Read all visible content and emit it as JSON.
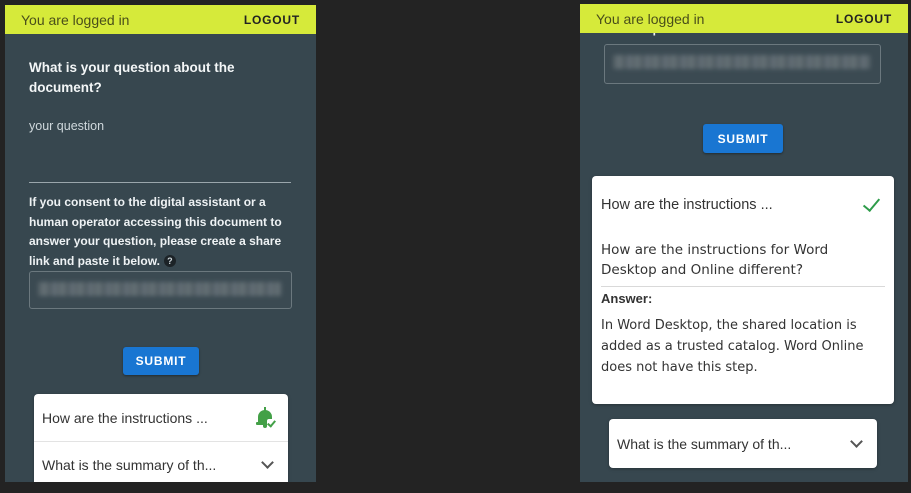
{
  "left": {
    "topbar": {
      "status": "You are logged in",
      "logout": "LOGOUT"
    },
    "question_title": "What is your question about the document?",
    "question_placeholder": "your question",
    "consent_text": "If you consent to the digital assistant or a human operator accessing this document to answer your question, please create a share link and paste it below.",
    "help_glyph": "?",
    "submit_label": "SUBMIT",
    "faq_items": [
      {
        "label": "How are the instructions ...",
        "icon": "bell-check-icon"
      },
      {
        "label": "What is the summary of th...",
        "icon": "chevron-down-icon"
      }
    ]
  },
  "right": {
    "topbar": {
      "status": "You are logged in",
      "logout": "LOGOUT"
    },
    "clipped_text": "link and paste it below.",
    "submit_label": "SUBMIT",
    "expanded_item": {
      "label": "How are the instructions ...",
      "icon": "check-icon",
      "question": "How are the instructions for Word Desktop and Online different?",
      "answer_label": "Answer:",
      "answer": "In Word Desktop, the shared location is added as a trusted catalog. Word Online does not have this step."
    },
    "collapsed_item": {
      "label": "What is the summary of th...",
      "icon": "chevron-down-icon"
    }
  },
  "colors": {
    "background": "#232323",
    "panel": "#37474f",
    "topbar": "#d6ea3a",
    "accent": "#1976d2",
    "success": "#43a047"
  }
}
